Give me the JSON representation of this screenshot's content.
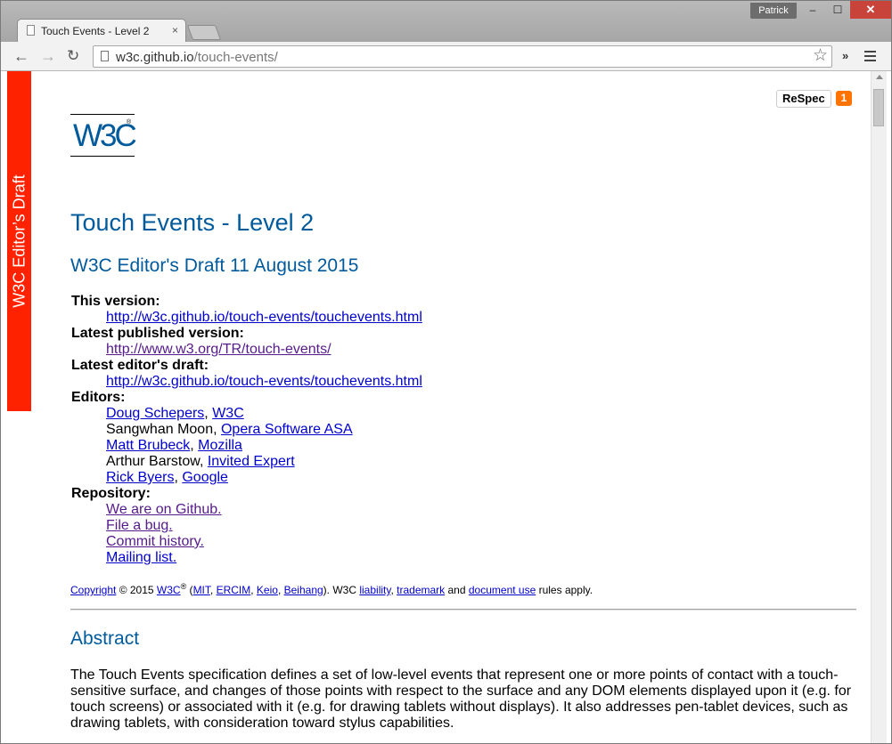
{
  "window": {
    "profile_name": "Patrick",
    "minimize": "–",
    "maximize": "☐",
    "close": "✕"
  },
  "tab": {
    "title": "Touch Events - Level 2",
    "close": "×"
  },
  "toolbar": {
    "back": "←",
    "forward": "→",
    "reload": "↻",
    "url_host": "w3c.github.io",
    "url_path": "/touch-events/",
    "star": "☆",
    "overflow": "»"
  },
  "ribbon": {
    "text": "W3C Editor’s Draft"
  },
  "respec": {
    "label": "ReSpec",
    "count": "1"
  },
  "logo": {
    "text": "W3C",
    "mark": "®"
  },
  "doc": {
    "title": "Touch Events - Level 2",
    "subtitle": "W3C Editor's Draft 11 August 2015",
    "this_version_label": "This version:",
    "this_version_url": "http://w3c.github.io/touch-events/touchevents.html",
    "latest_published_label": "Latest published version:",
    "latest_published_url": "http://www.w3.org/TR/touch-events/",
    "latest_draft_label": "Latest editor's draft:",
    "latest_draft_url": "http://w3c.github.io/touch-events/touchevents.html",
    "editors_label": "Editors:",
    "editors": [
      {
        "name": "Doug Schepers",
        "name_link": true,
        "org": "W3C"
      },
      {
        "name": "Sangwhan Moon",
        "name_link": false,
        "org": "Opera Software ASA"
      },
      {
        "name": "Matt Brubeck",
        "name_link": true,
        "org": "Mozilla"
      },
      {
        "name": "Arthur Barstow",
        "name_link": false,
        "org": "Invited Expert"
      },
      {
        "name": "Rick Byers",
        "name_link": true,
        "org": "Google"
      }
    ],
    "repository_label": "Repository:",
    "repository_links": [
      "We are on Github.",
      "File a bug.",
      "Commit history.",
      "Mailing list."
    ],
    "copyright": {
      "copyright": "Copyright",
      "year": " © 2015 ",
      "w3c": "W3C",
      "reg": "®",
      "open": " (",
      "mit": "MIT",
      "ercim": "ERCIM",
      "keio": "Keio",
      "beihang": "Beihang",
      "mid": "). W3C ",
      "liability": "liability",
      "trademark": "trademark",
      "and": " and ",
      "document_use": "document use",
      "end": " rules apply."
    },
    "abstract_heading": "Abstract",
    "abstract_text": "The Touch Events specification defines a set of low-level events that represent one or more points of contact with a touch-sensitive surface, and changes of those points with respect to the surface and any DOM elements displayed upon it (e.g. for touch screens) or associated with it (e.g. for drawing tablets without displays). It also addresses pen-tablet devices, such as drawing tablets, with consideration toward stylus capabilities."
  }
}
